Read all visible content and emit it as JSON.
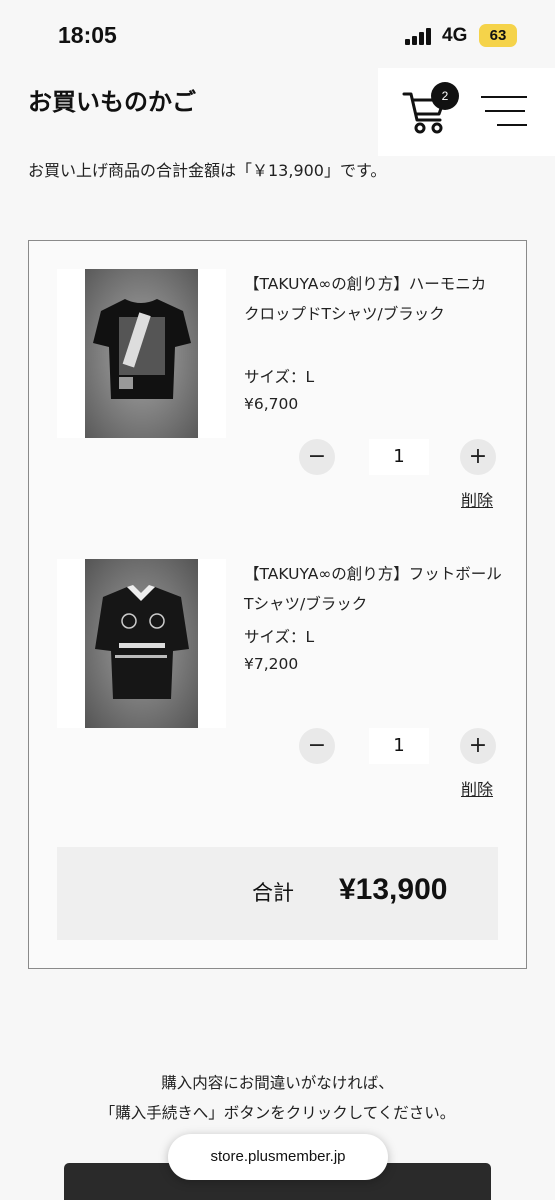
{
  "status_bar": {
    "time": "18:05",
    "network": "4G",
    "battery": "63"
  },
  "header": {
    "title": "お買いものかご",
    "cart_count": "2",
    "cart_icon": "cart-icon",
    "menu_icon": "hamburger-menu-icon"
  },
  "summary": "お買い上げ商品の合計金額は「￥13,900」です。",
  "items": [
    {
      "name": "【TAKUYA∞の創り方】ハーモニカ クロップドTシャツ/ブラック",
      "size": "サイズ：L",
      "price": "¥6,700",
      "quantity": "1",
      "delete": "削除"
    },
    {
      "name": "【TAKUYA∞の創り方】フットボール Tシャツ/ブラック",
      "size": "サイズ：L",
      "price": "¥7,200",
      "quantity": "1",
      "delete": "削除"
    }
  ],
  "total": {
    "label": "合計",
    "amount": "¥13,900"
  },
  "notice": {
    "line1": "購入内容にお間違いがなければ、",
    "line2": "「購入手続きへ」ボタンをクリックしてください。"
  },
  "browser": {
    "url": "store.plusmember.jp"
  },
  "colors": {
    "battery": "#f5d34a",
    "checkout_button": "#2a2a2a",
    "badge": "#111111"
  }
}
